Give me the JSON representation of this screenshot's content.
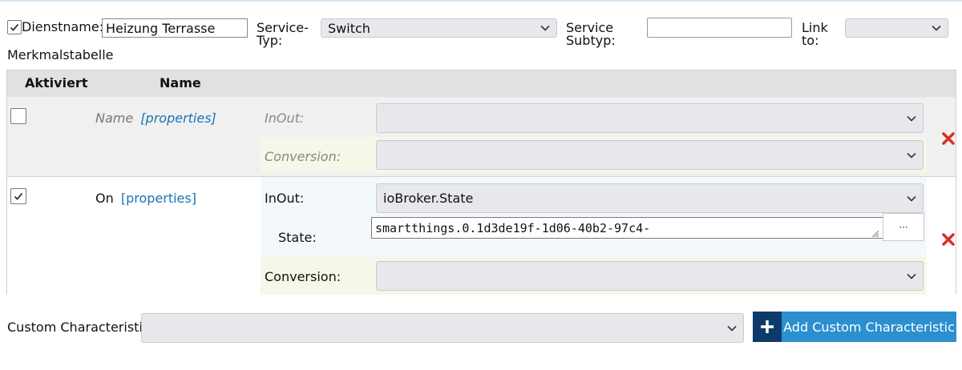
{
  "header": {
    "dienstname_label": "Dienstname:",
    "dienstname_value": "Heizung Terrasse",
    "service_typ_label_1": "Service-",
    "service_typ_label_2": "Typ:",
    "service_typ_value": "Switch",
    "service_subtyp_label_1": "Service",
    "service_subtyp_label_2": "Subtyp:",
    "service_subtyp_value": "",
    "link_to_label_1": "Link",
    "link_to_label_2": "to:",
    "link_to_value": "",
    "dienstname_checked": true
  },
  "section_title": "Merkmalstabelle",
  "table": {
    "col_aktiviert": "Aktiviert",
    "col_name": "Name",
    "rows": [
      {
        "checked": false,
        "name": "Name",
        "properties_link": "[properties]",
        "inout_label": "InOut:",
        "inout_value": "",
        "conversion_label": "Conversion:",
        "conversion_value": ""
      },
      {
        "checked": true,
        "name": "On",
        "properties_link": "[properties]",
        "inout_label": "InOut:",
        "inout_value": "ioBroker.State",
        "state_label": "State:",
        "state_value": "smartthings.0.1d3de19f-1d06-40b2-97c4-",
        "state_more": "···",
        "conversion_label": "Conversion:",
        "conversion_value": ""
      }
    ]
  },
  "footer": {
    "custom_label": "Custom Characteristic",
    "custom_value": "",
    "add_button_label": "Add Custom Characteristic",
    "plus_symbol": "+"
  },
  "colors": {
    "delete_red": "#d93025",
    "button_blue": "#2b8fd0",
    "button_dark": "#0c3a6a",
    "link_blue": "#1a73b5"
  }
}
